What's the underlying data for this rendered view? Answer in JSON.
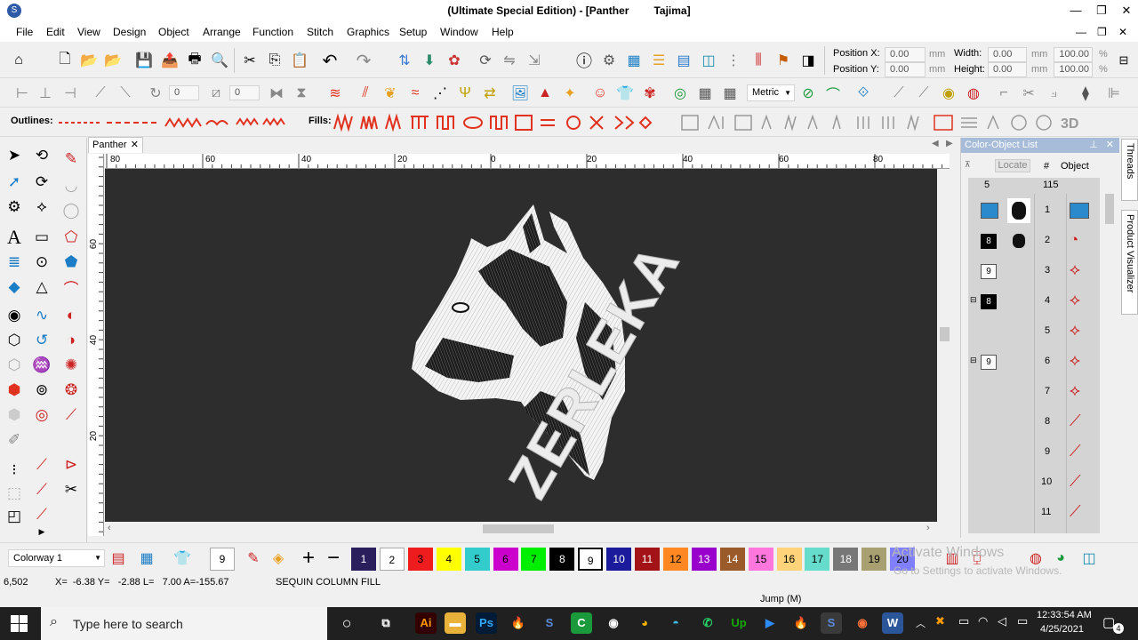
{
  "window": {
    "title_edition": "(Ultimate Special Edition) - [Panther",
    "title_machine": "Tajima]",
    "minimize": "—",
    "restore": "❐",
    "close": "✕"
  },
  "menu": [
    "File",
    "Edit",
    "View",
    "Design",
    "Object",
    "Arrange",
    "Function",
    "Stitch",
    "Graphics",
    "Setup",
    "Window",
    "Help"
  ],
  "mdi_controls": {
    "minimize": "—",
    "restore": "❐",
    "close": "✕"
  },
  "position": {
    "x_label": "Position X:",
    "x_value": "0.00",
    "y_label": "Position Y:",
    "y_value": "0.00",
    "unit": "mm"
  },
  "size": {
    "w_label": "Width:",
    "w_value": "0.00",
    "h_label": "Height:",
    "h_value": "0.00",
    "unit": "mm",
    "w_pct": "100.00",
    "h_pct": "100.00",
    "pct_unit": "%"
  },
  "toolbar2": {
    "rotate_value": "0",
    "slant_value": "0",
    "units_select": "Metric"
  },
  "toolbar3": {
    "outlines_label": "Outlines:",
    "fills_label": "Fills:",
    "threed_label": "3D"
  },
  "document": {
    "tab_label": "Panther",
    "tab_close": "✕",
    "ruler_h": [
      "80",
      "60",
      "40",
      "20",
      "0",
      "20",
      "40",
      "60",
      "80"
    ],
    "ruler_v": [
      "60",
      "40",
      "20"
    ],
    "design_text": "ZERLEKA"
  },
  "color_object_list": {
    "title": "Color-Object List",
    "locate_label": "Locate",
    "col_hash": "#",
    "col_object": "Object",
    "count_left": "5",
    "count_total": "115",
    "rows": [
      {
        "color": "",
        "num": "1"
      },
      {
        "color": "8",
        "num": "2"
      },
      {
        "color": "9",
        "num": "3"
      },
      {
        "color": "8",
        "num": "4"
      },
      {
        "color": "",
        "num": "5"
      },
      {
        "color": "9",
        "num": "6"
      },
      {
        "color": "",
        "num": "7"
      },
      {
        "color": "",
        "num": "8"
      },
      {
        "color": "",
        "num": "9"
      },
      {
        "color": "",
        "num": "10"
      },
      {
        "color": "",
        "num": "11"
      }
    ]
  },
  "side_tabs": {
    "threads": "Threads",
    "visualizer": "Product Visualizer"
  },
  "colorbar": {
    "colorway": "Colorway 1",
    "current_color": "9",
    "swatches": [
      {
        "n": "1",
        "c": "#2a1f5c",
        "t": "#ffffff"
      },
      {
        "n": "2",
        "c": "#ffffff",
        "t": "#000000"
      },
      {
        "n": "3",
        "c": "#ee1c1c",
        "t": "#000000"
      },
      {
        "n": "4",
        "c": "#ffff00",
        "t": "#000000"
      },
      {
        "n": "5",
        "c": "#33cccc",
        "t": "#000000"
      },
      {
        "n": "6",
        "c": "#cc00cc",
        "t": "#000000"
      },
      {
        "n": "7",
        "c": "#00ee00",
        "t": "#000000"
      },
      {
        "n": "8",
        "c": "#000000",
        "t": "#ffffff"
      },
      {
        "n": "9",
        "c": "#ffffff",
        "t": "#000000"
      },
      {
        "n": "10",
        "c": "#1b1b9c",
        "t": "#ffffff"
      },
      {
        "n": "11",
        "c": "#a31216",
        "t": "#ffffff"
      },
      {
        "n": "12",
        "c": "#ff8822",
        "t": "#000000"
      },
      {
        "n": "13",
        "c": "#9900cc",
        "t": "#ffffff"
      },
      {
        "n": "14",
        "c": "#9b5a2a",
        "t": "#ffffff"
      },
      {
        "n": "15",
        "c": "#ff77dd",
        "t": "#000000"
      },
      {
        "n": "16",
        "c": "#ffd37a",
        "t": "#000000"
      },
      {
        "n": "17",
        "c": "#66ddcc",
        "t": "#000000"
      },
      {
        "n": "18",
        "c": "#777777",
        "t": "#ffffff"
      },
      {
        "n": "19",
        "c": "#a8a070",
        "t": "#000000"
      },
      {
        "n": "20",
        "c": "#7f7fff",
        "t": "#000000"
      }
    ]
  },
  "status": {
    "stitch": "6,502",
    "coords": "X=  -6.38 Y=   -2.88 L=   7.00 A=-155.67",
    "mode": "SEQUIN COLUMN FILL",
    "jump": "Jump (M)",
    "watermark_1": "Activate Windows",
    "watermark_2": "Go to Settings to activate Windows."
  },
  "taskbar": {
    "search_placeholder": "Type here to search",
    "time": "12:33:54 AM",
    "date": "4/25/2021",
    "notifications": "4"
  }
}
